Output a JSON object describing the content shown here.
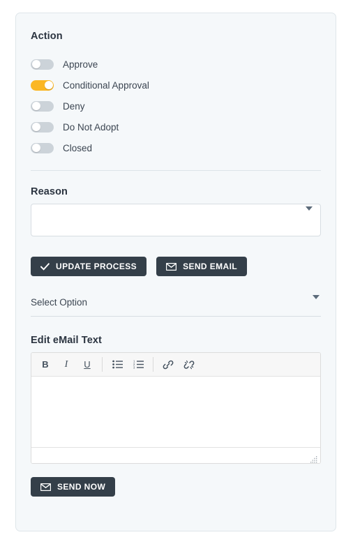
{
  "card": {
    "action": {
      "heading": "Action",
      "toggles": [
        {
          "label": "Approve",
          "on": false,
          "name": "toggle-approve"
        },
        {
          "label": "Conditional Approval",
          "on": true,
          "name": "toggle-conditional-approval"
        },
        {
          "label": "Deny",
          "on": false,
          "name": "toggle-deny"
        },
        {
          "label": "Do Not Adopt",
          "on": false,
          "name": "toggle-do-not-adopt"
        },
        {
          "label": "Closed",
          "on": false,
          "name": "toggle-closed"
        }
      ]
    },
    "reason": {
      "heading": "Reason",
      "value": "",
      "placeholder": "",
      "caret_icon": "chevron-down-icon"
    },
    "buttons": {
      "update_process": {
        "label": "UPDATE PROCESS",
        "icon": "check-icon"
      },
      "send_email": {
        "label": "SEND EMAIL",
        "icon": "envelope-icon"
      },
      "send_now": {
        "label": "SEND NOW",
        "icon": "envelope-icon"
      }
    },
    "select_option": {
      "selected": "Select Option",
      "caret_icon": "chevron-down-icon"
    },
    "editor": {
      "heading": "Edit eMail Text",
      "content": "",
      "toolbar": [
        {
          "label": "B",
          "name": "bold-icon",
          "kind": "bold"
        },
        {
          "label": "I",
          "name": "italic-icon",
          "kind": "italic"
        },
        {
          "label": "U",
          "name": "underline-icon",
          "kind": "under"
        },
        {
          "label": "",
          "name": "bullet-list-icon",
          "kind": "svg-ul"
        },
        {
          "label": "",
          "name": "numbered-list-icon",
          "kind": "svg-ol"
        },
        {
          "label": "",
          "name": "link-icon",
          "kind": "svg-link"
        },
        {
          "label": "",
          "name": "unlink-icon",
          "kind": "svg-unlink"
        }
      ],
      "resize_grip_icon": "resize-grip-icon"
    }
  },
  "colors": {
    "accent": "#fbb724",
    "button_dark": "#343f49",
    "card_bg": "#f5f8fa",
    "toggle_off": "#ccd3d9",
    "text": "#3b4551",
    "heading": "#2b3440"
  }
}
